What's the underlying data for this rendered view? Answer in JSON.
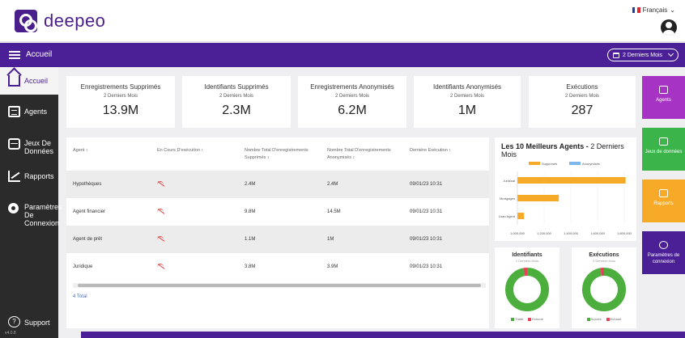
{
  "header": {
    "brand": "deepeo",
    "language": "Français",
    "language_caret": "⌄"
  },
  "navbar": {
    "title": "Accueil",
    "period": "2 Derniers Mois"
  },
  "sidebar": {
    "items": [
      {
        "label": "Accueil",
        "icon": "home-icon"
      },
      {
        "label": "Agents",
        "icon": "list-icon"
      },
      {
        "label": "Jeux De Données",
        "icon": "database-icon"
      },
      {
        "label": "Rapports",
        "icon": "chart-icon"
      },
      {
        "label": "Paramètres De Connexion",
        "icon": "gear-icon"
      }
    ],
    "support": "Support",
    "version": "v4.0.8"
  },
  "kpis": [
    {
      "title": "Enregistrements Supprimés",
      "sub": "2 Derniers Mois",
      "value": "13.9M"
    },
    {
      "title": "Identifiants Supprimés",
      "sub": "2 Derniers Mois",
      "value": "2.3M"
    },
    {
      "title": "Enregistrements Anonymisés",
      "sub": "2 Derniers Mois",
      "value": "6.2M"
    },
    {
      "title": "Identifiants Anonymisés",
      "sub": "2 Derniers Mois",
      "value": "1M"
    },
    {
      "title": "Exécutions",
      "sub": "2 Derniers Mois",
      "value": "287"
    }
  ],
  "tiles": [
    {
      "label": "Agents",
      "color": "#a733c5",
      "icon": "list-icon"
    },
    {
      "label": "Jeux de données",
      "color": "#3bb54a",
      "icon": "database-icon"
    },
    {
      "label": "Rapports",
      "color": "#f7a928",
      "icon": "chart-icon"
    },
    {
      "label": "Paramètres de connexion",
      "color": "#4b1f96",
      "icon": "gear-icon"
    }
  ],
  "table": {
    "headers": [
      "Agent ↕",
      "En Cours D'exécution ↕",
      "Nombre Total D'enregistrements Supprimés ↕",
      "Nombre Total D'enregistrements Anonymisés ↕",
      "Dernière Exécution ↕"
    ],
    "rows": [
      {
        "agent": "Hypothèques",
        "deleted": "2.4M",
        "anonymized": "2.4M",
        "last": "09/01/23 10:31"
      },
      {
        "agent": "Agent financier",
        "deleted": "9.8M",
        "anonymized": "14.5M",
        "last": "09/01/23 10:31"
      },
      {
        "agent": "Agent de prêt",
        "deleted": "1.1M",
        "anonymized": "1M",
        "last": "09/01/23 10:31"
      },
      {
        "agent": "Juridique",
        "deleted": "3.8M",
        "anonymized": "3.9M",
        "last": "09/01/23 10:31"
      }
    ],
    "total": "4 Total"
  },
  "donuts": [
    {
      "title": "Identifiants",
      "sub": "2 Derniers Mois",
      "legend": [
        "Traité",
        "Echoué"
      ]
    },
    {
      "title": "Exécutions",
      "sub": "2 Derniers Mois",
      "legend": [
        "Succès",
        "Echoué"
      ]
    }
  ],
  "colors": {
    "purple": "#4b1f96",
    "bar_deleted": "#f7a928",
    "bar_anonymized": "#7cb7e8",
    "success": "#4caf3d",
    "failed": "#e8415a"
  },
  "chart_data": [
    {
      "type": "bar",
      "orientation": "horizontal",
      "title_bold": "Les 10 Meilleurs Agents - ",
      "title_rest": "2 Derniers Mois",
      "categories": [
        "Juridical",
        "Mortgages",
        "Loan Agent"
      ],
      "series": [
        {
          "name": "Supprimés",
          "values": [
            1810000,
            1310000,
            1050000
          ]
        },
        {
          "name": "Anonymisés",
          "values": [
            0,
            0,
            0
          ]
        }
      ],
      "xticks": [
        "1,000,000",
        "1,200,000",
        "1,400,000",
        "1,600,000",
        "1,800,000"
      ],
      "xlim": [
        1000000,
        1800000
      ],
      "legend_position": "top"
    },
    {
      "type": "pie",
      "title": "Identifiants",
      "labels": [
        "Traité",
        "Echoué"
      ],
      "values": [
        97,
        3
      ]
    },
    {
      "type": "pie",
      "title": "Exécutions",
      "labels": [
        "Succès",
        "Echoué"
      ],
      "values": [
        97,
        3
      ]
    }
  ]
}
